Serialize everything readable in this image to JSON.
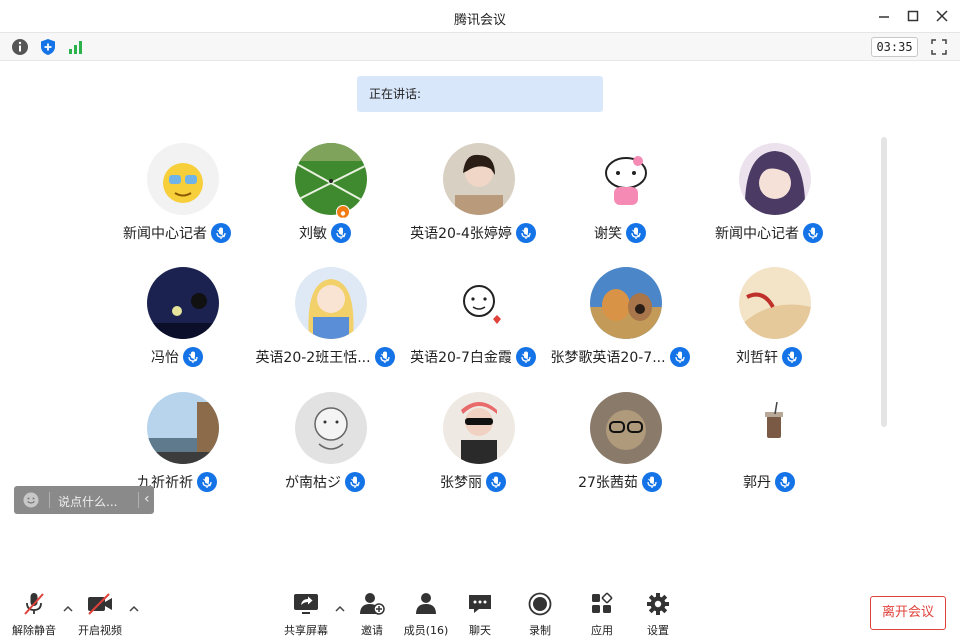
{
  "window": {
    "title": "腾讯会议"
  },
  "info_bar": {
    "timer": "03:35"
  },
  "speaking": {
    "label": "正在讲话:"
  },
  "participants": [
    {
      "name": "新闻中心记者"
    },
    {
      "name": "刘敏"
    },
    {
      "name": "英语20-4张婷婷"
    },
    {
      "name": "谢笑"
    },
    {
      "name": "新闻中心记者"
    },
    {
      "name": "冯怡"
    },
    {
      "name": "英语20-2班王恬..."
    },
    {
      "name": "英语20-7白金霞"
    },
    {
      "name": "张梦歌英语20-7..."
    },
    {
      "name": "刘哲轩"
    },
    {
      "name": "九祈祈祈"
    },
    {
      "name": "が南枯ジ"
    },
    {
      "name": "张梦丽"
    },
    {
      "name": "27张茜茹"
    },
    {
      "name": "郭丹"
    }
  ],
  "chat": {
    "placeholder": "说点什么..."
  },
  "toolbar": {
    "unmute": "解除静音",
    "video": "开启视频",
    "share": "共享屏幕",
    "invite": "邀请",
    "members": "成员(16)",
    "chat": "聊天",
    "record": "录制",
    "apps": "应用",
    "settings": "设置",
    "leave": "离开会议"
  },
  "colors": {
    "accent": "#1473e6",
    "leave": "#e0413b",
    "speaking_bg": "#d9e7fb"
  }
}
